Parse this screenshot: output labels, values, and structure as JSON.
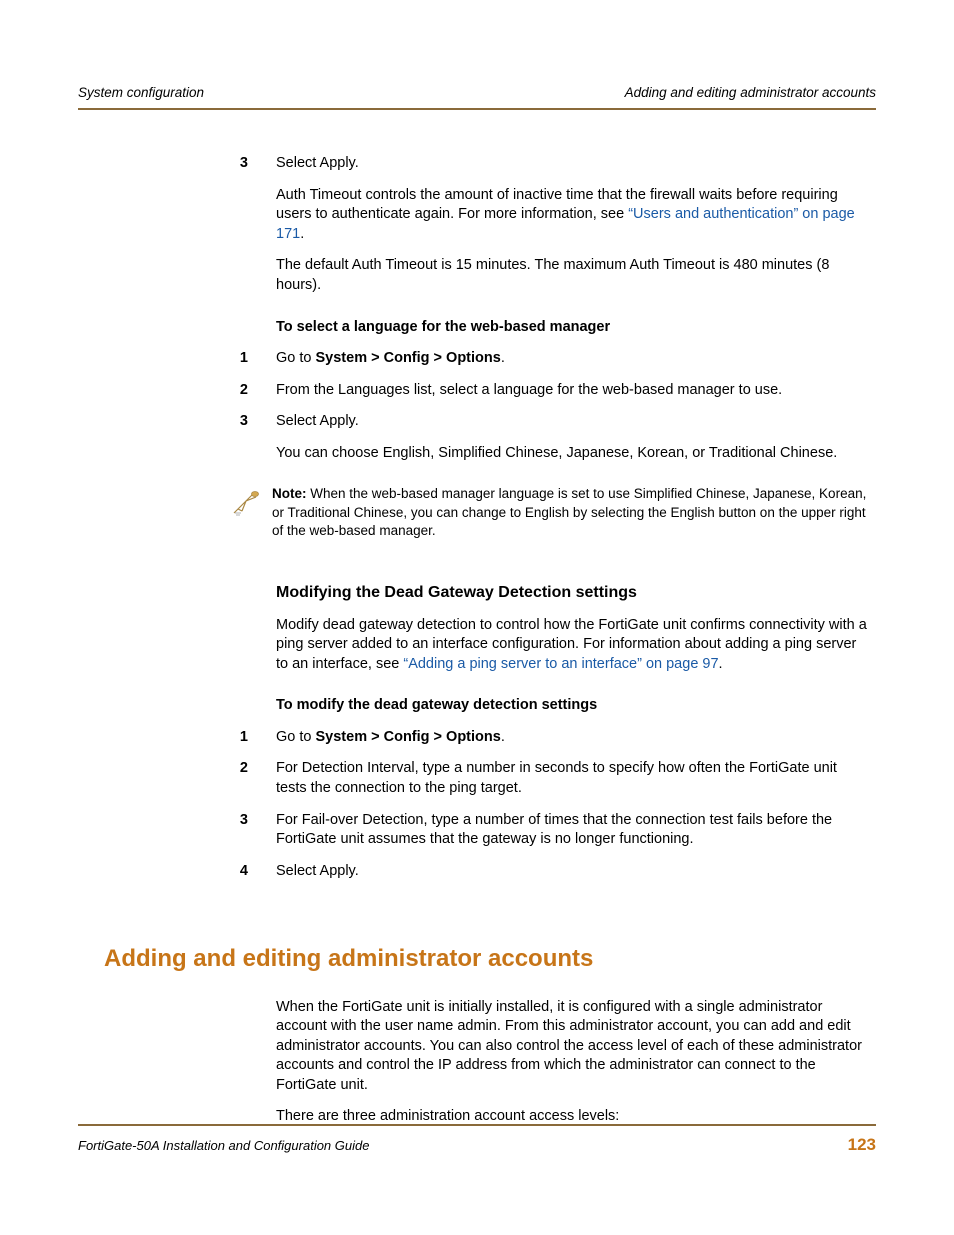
{
  "header": {
    "left": "System configuration",
    "right": "Adding and editing administrator accounts"
  },
  "steps_a": {
    "num3": "3",
    "text3": "Select Apply.",
    "para1_a": "Auth Timeout controls the amount of inactive time that the firewall waits before requiring users to authenticate again. For more information, see ",
    "para1_link": "“Users and authentication” on page 171",
    "para1_b": ".",
    "para2": "The default Auth Timeout is 15 minutes. The maximum Auth Timeout is 480 minutes (8 hours)."
  },
  "lang_section": {
    "heading": "To select a language for the web-based manager",
    "s1_num": "1",
    "s1_a": "Go to ",
    "s1_b": "System > Config > Options",
    "s1_c": ".",
    "s2_num": "2",
    "s2": "From the Languages list, select a language for the web-based manager to use.",
    "s3_num": "3",
    "s3": "Select Apply.",
    "para": "You can choose English, Simplified Chinese, Japanese, Korean, or Traditional Chinese."
  },
  "note": {
    "label": "Note: ",
    "text": "When the web-based manager language is set to use Simplified Chinese, Japanese, Korean, or Traditional Chinese, you can change to English by selecting the English button on the upper right of the web-based manager."
  },
  "dead_gw": {
    "heading": "Modifying the Dead Gateway Detection settings",
    "para1_a": "Modify dead gateway detection to control how the FortiGate unit confirms connectivity with a ping server added to an interface configuration. For information about adding a ping server to an interface, see ",
    "para1_link": "“Adding a ping server to an interface” on page 97",
    "para1_b": ".",
    "subheading": "To modify the dead gateway detection settings",
    "s1_num": "1",
    "s1_a": "Go to ",
    "s1_b": "System > Config > Options",
    "s1_c": ".",
    "s2_num": "2",
    "s2": "For Detection Interval, type a number in seconds to specify how often the FortiGate unit tests the connection to the ping target.",
    "s3_num": "3",
    "s3": "For Fail-over Detection, type a number of times that the connection test fails before the FortiGate unit assumes that the gateway is no longer functioning.",
    "s4_num": "4",
    "s4": "Select Apply."
  },
  "admin": {
    "heading": "Adding and editing administrator accounts",
    "para1": "When the FortiGate unit is initially installed, it is configured with a single administrator account with the user name admin. From this administrator account, you can add and edit administrator accounts. You can also control the access level of each of these administrator accounts and control the IP address from which the administrator can connect to the FortiGate unit.",
    "para2": "There are three administration account access levels:"
  },
  "footer": {
    "left": "FortiGate-50A Installation and Configuration Guide",
    "page": "123"
  }
}
